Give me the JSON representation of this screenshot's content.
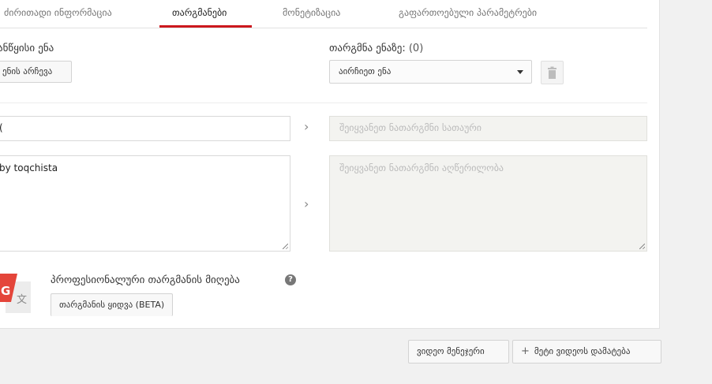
{
  "tabs": [
    {
      "label": "ძირითადი ინფორმაცია"
    },
    {
      "label": "თარგმანები"
    },
    {
      "label": "მონეტიზაცია"
    },
    {
      "label": "გაფართოებული პარამეტრები"
    }
  ],
  "original": {
    "language_label": "ანწყისი ენა",
    "choose_button": "ენის არჩევა",
    "title_value": "(",
    "description_value": "by toqchista"
  },
  "translation": {
    "language_label": "თარგმნა ენაზე:",
    "count": "(0)",
    "select_value": "აირჩიეთ ენა",
    "title_placeholder": "შეიყვანეთ ნათარგმნი სათაური",
    "description_placeholder": "შეიყვანეთ ნათარგმნი აღწერილობა"
  },
  "professional": {
    "title": "პროფესიონალური თარგმანის მიღება",
    "help_icon": "?",
    "buy_button": "თარგმანის ყიდვა  (BETA)"
  },
  "footer": {
    "video_manager_button": "ვიდეო მენეჯერი",
    "add_videos_icon": "+",
    "add_videos_button": "მეტი ვიდეოს დამატება"
  },
  "colors": {
    "accent": "#cc181e",
    "disabled_field": "#f3f3f0"
  }
}
